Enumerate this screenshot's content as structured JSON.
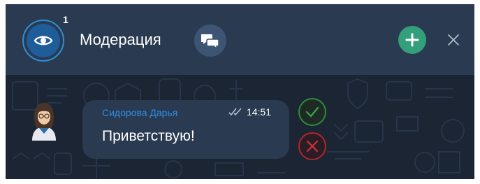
{
  "header": {
    "moderation_count": "1",
    "title": "Модерация"
  },
  "message": {
    "author": "Сидорова Дарья",
    "time": "14:51",
    "text": "Приветствую!"
  },
  "icons": {
    "moderation": "eye-icon",
    "chats": "chat-bubbles-icon",
    "add": "plus-icon",
    "close": "close-icon",
    "read_status": "double-check-icon",
    "approve": "check-icon",
    "reject": "cross-icon"
  },
  "colors": {
    "header_bg": "#2a3a51",
    "chat_bg": "#1b2533",
    "accent_blue": "#2b8fd6",
    "author_blue": "#2d8fe6",
    "add_green": "#34a07b",
    "approve_green": "#2f8a3c",
    "reject_red": "#b0262c"
  }
}
